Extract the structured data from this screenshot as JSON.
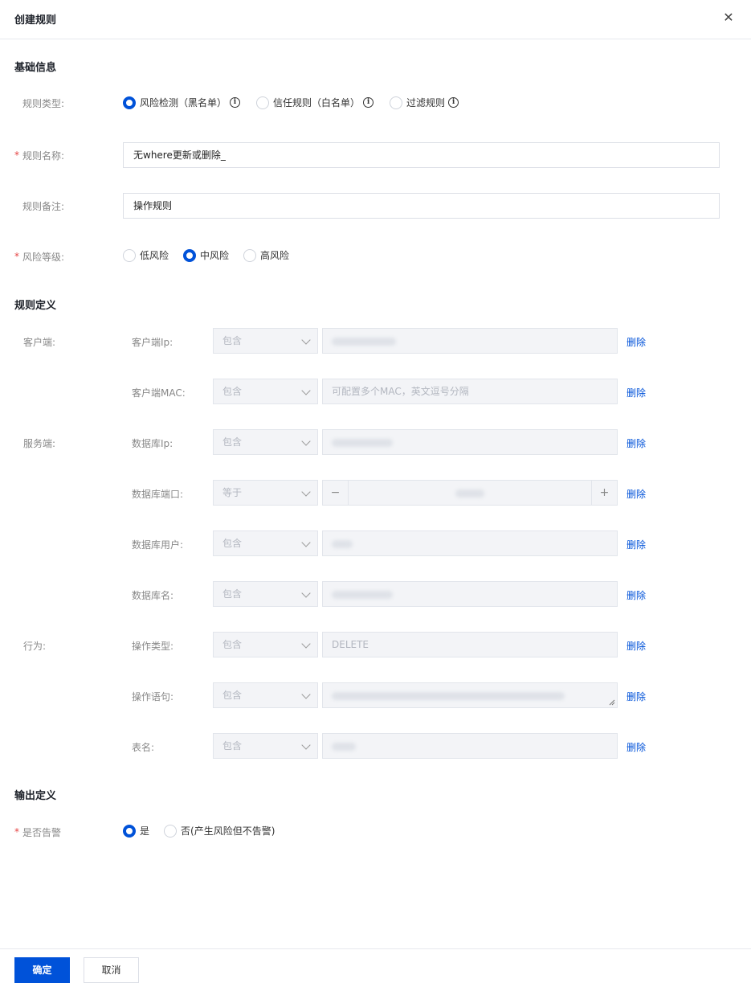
{
  "dialog": {
    "title": "创建规则",
    "close_icon": "close-icon"
  },
  "basic": {
    "section_title": "基础信息",
    "rule_type": {
      "label": "规则类型:",
      "options": [
        "风险检测（黑名单）",
        "信任规则（白名单）",
        "过滤规则"
      ],
      "selected": "风险检测（黑名单）"
    },
    "rule_name": {
      "label": "规则名称:",
      "value": "无where更新或删除_"
    },
    "rule_note": {
      "label": "规则备注:",
      "value": "操作规则"
    },
    "risk_level": {
      "label": "风险等级:",
      "options": [
        "低风险",
        "中风险",
        "高风险"
      ],
      "selected": "中风险"
    }
  },
  "definition": {
    "section_title": "规则定义",
    "groups": {
      "client": "客户端:",
      "server": "服务端:",
      "behavior": "行为:"
    },
    "rows": [
      {
        "label": "客户端Ip:",
        "operator": "包含",
        "value": "",
        "delete": "删除"
      },
      {
        "label": "客户端MAC:",
        "operator": "包含",
        "placeholder": "可配置多个MAC，英文逗号分隔",
        "delete": "删除"
      },
      {
        "label": "数据库Ip:",
        "operator": "包含",
        "value": "",
        "delete": "删除"
      },
      {
        "label": "数据库端口:",
        "operator": "等于",
        "value": "",
        "minus": "−",
        "plus": "+",
        "delete": "删除"
      },
      {
        "label": "数据库用户:",
        "operator": "包含",
        "value": "",
        "delete": "删除"
      },
      {
        "label": "数据库名:",
        "operator": "包含",
        "value": "",
        "delete": "删除"
      },
      {
        "label": "操作类型:",
        "operator": "包含",
        "value": "DELETE",
        "delete": "删除"
      },
      {
        "label": "操作语句:",
        "operator": "包含",
        "value": "",
        "delete": "删除"
      },
      {
        "label": "表名:",
        "operator": "包含",
        "value": "",
        "delete": "删除"
      }
    ]
  },
  "output": {
    "section_title": "输出定义",
    "alert": {
      "label": "是否告警",
      "options": [
        "是",
        "否(产生风险但不告警)"
      ],
      "selected": "是"
    }
  },
  "footer": {
    "confirm": "确定",
    "cancel": "取消"
  },
  "colors": {
    "primary": "#0052d9",
    "required": "#e54545"
  }
}
